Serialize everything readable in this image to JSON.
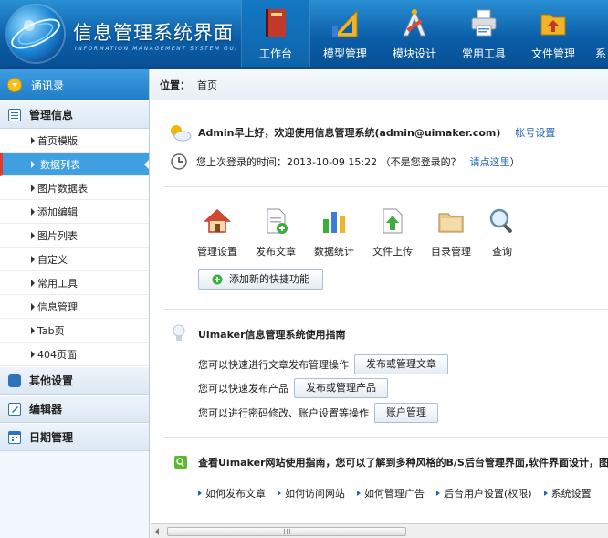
{
  "header": {
    "title": "信息管理系统界面",
    "subtitle": "INFORMATION MANAGEMENT SYSTEM GUI",
    "nav": [
      {
        "label": "工作台",
        "icon": "book-icon",
        "active": true
      },
      {
        "label": "模型管理",
        "icon": "ruler-triangle-icon",
        "active": false
      },
      {
        "label": "模块设计",
        "icon": "drafting-tools-icon",
        "active": false
      },
      {
        "label": "常用工具",
        "icon": "printer-icon",
        "active": false
      },
      {
        "label": "文件管理",
        "icon": "folder-download-icon",
        "active": false
      },
      {
        "label": "系",
        "icon": "partial-icon",
        "active": false
      }
    ]
  },
  "sidebar": {
    "contacts": "通讯录",
    "groups": [
      {
        "label": "管理信息",
        "icon": "list-icon"
      },
      {
        "label": "其他设置",
        "icon": "chat-icon"
      },
      {
        "label": "编辑器",
        "icon": "edit-icon"
      },
      {
        "label": "日期管理",
        "icon": "calendar-icon"
      }
    ],
    "items": [
      "首页模版",
      "数据列表",
      "图片数据表",
      "添加编辑",
      "图片列表",
      "自定义",
      "常用工具",
      "信息管理",
      "Tab页",
      "404页面"
    ],
    "active_item": "数据列表"
  },
  "breadcrumb": {
    "label": "位置：",
    "current": "首页"
  },
  "welcome": {
    "greeting": "Admin早上好，欢迎使用信息管理系统(admin@uimaker.com)",
    "account_link": "帐号设置",
    "last_login": "您上次登录的时间：2013-10-09 15:22 （不是您登录的？",
    "click_here": "请点这里",
    "close_paren": "）"
  },
  "quick_actions": [
    {
      "label": "管理设置",
      "icon": "house-icon"
    },
    {
      "label": "发布文章",
      "icon": "document-add-icon"
    },
    {
      "label": "数据统计",
      "icon": "bar-stats-icon"
    },
    {
      "label": "文件上传",
      "icon": "upload-icon"
    },
    {
      "label": "目录管理",
      "icon": "folder-icon"
    },
    {
      "label": "查询",
      "icon": "magnifier-icon"
    }
  ],
  "add_quick": "添加新的快捷功能",
  "guide": {
    "title": "Uimaker信息管理系统使用指南",
    "rows": [
      {
        "text": "您可以快速进行文章发布管理操作",
        "button": "发布或管理文章"
      },
      {
        "text": "您可以快速发布产品",
        "button": "发布或管理产品"
      },
      {
        "text": "您可以进行密码修改、账户设置等操作",
        "button": "账户管理"
      }
    ]
  },
  "website_guide": {
    "title": "查看Uimaker网站使用指南，您可以了解到多种风格的B/S后台管理界面,软件界面设计，图标设计",
    "links": [
      "如何发布文章",
      "如何访问网站",
      "如何管理广告",
      "后台用户设置(权限)",
      "系统设置"
    ]
  },
  "colors": {
    "header": "#0a5ea8",
    "accent": "#3f9fe0",
    "link": "#1f65b6",
    "active_marker": "#e63a2b"
  }
}
